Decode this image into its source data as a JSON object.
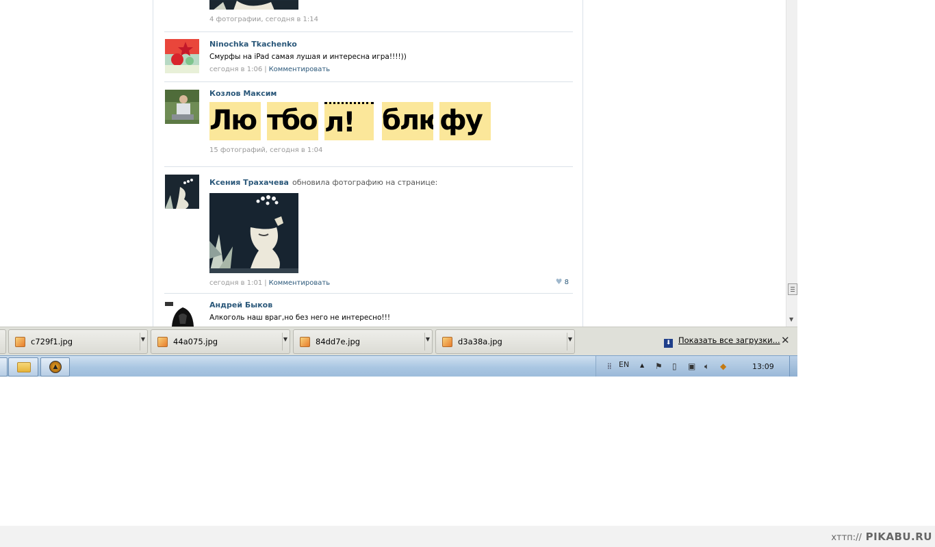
{
  "feed": {
    "top_post": {
      "meta": "4 фотографии, сегодня в 1:14"
    },
    "posts": [
      {
        "author": "Ninochka Tkachenko",
        "text": "Смурфы на iPad самая лушая и интересна игра!!!!))",
        "meta": "сегодня в 1:06",
        "comment_link": "Комментировать"
      },
      {
        "author": "Козлов Максим",
        "photo_text": [
          "Лю",
          "тбо",
          "л!",
          "блю",
          "фу"
        ],
        "meta": "15 фотографий, сегодня в 1:04"
      },
      {
        "author": "Ксения Трахачева",
        "action": "обновила фотографию на странице:",
        "meta": "сегодня в 1:01",
        "comment_link": "Комментировать",
        "likes": "8"
      },
      {
        "author": "Андрей Быков",
        "text": "Алкоголь наш враг,но без него не интересно!!!"
      }
    ]
  },
  "downloads": {
    "items": [
      "c729f1.jpg",
      "44a075.jpg",
      "84dd7e.jpg",
      "d3a38a.jpg"
    ],
    "show_all": "Показать все загрузки..."
  },
  "taskbar": {
    "lang": "EN",
    "clock": "13:09"
  },
  "watermark": {
    "prefix": "хттп://",
    "site": "PIKABU.RU"
  }
}
